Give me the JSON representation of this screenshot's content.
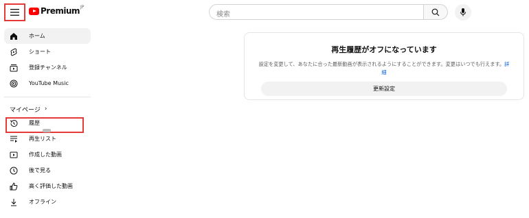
{
  "header": {
    "logo_text": "Premium",
    "logo_sup": "JP",
    "search_placeholder": "検索"
  },
  "sidebar": {
    "top_items": [
      {
        "label": "ホーム",
        "icon": "home-icon",
        "active": true
      },
      {
        "label": "ショート",
        "icon": "shorts-icon"
      },
      {
        "label": "登録チャンネル",
        "icon": "subscriptions-icon"
      },
      {
        "label": "YouTube Music",
        "icon": "youtube-music-icon"
      }
    ],
    "section_title": "マイページ",
    "you_items": [
      {
        "label": "履歴",
        "icon": "history-icon"
      },
      {
        "label": "再生リスト",
        "icon": "playlists-icon"
      },
      {
        "label": "作成した動画",
        "icon": "your-videos-icon"
      },
      {
        "label": "後で見る",
        "icon": "watch-later-icon"
      },
      {
        "label": "高く評価した動画",
        "icon": "liked-videos-icon"
      },
      {
        "label": "オフライン",
        "icon": "downloads-icon"
      }
    ]
  },
  "main": {
    "title": "再生履歴がオフになっています",
    "body": "設定を変更して、あなたに合った最新動画が表示されるようにすることができます。変更はいつでも行えます。",
    "link": "詳細",
    "button": "更新設定"
  },
  "colors": {
    "brand": "#ff0000",
    "highlight": "#e53935",
    "link": "#065fd4"
  }
}
